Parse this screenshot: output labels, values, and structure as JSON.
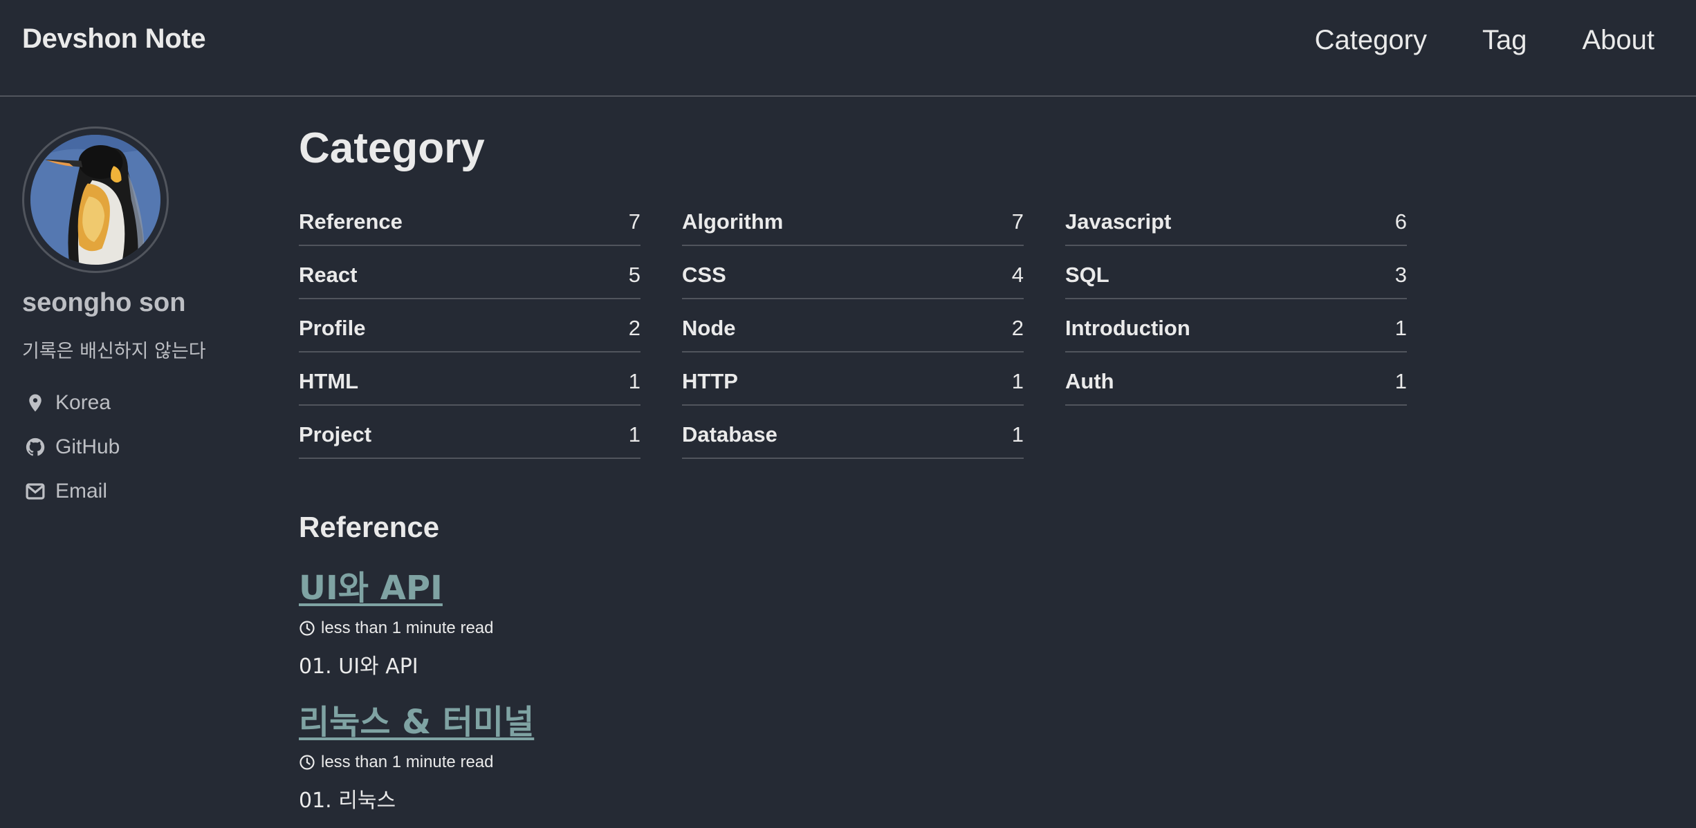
{
  "site": {
    "title": "Devshon Note"
  },
  "nav": {
    "items": [
      {
        "label": "Category"
      },
      {
        "label": "Tag"
      },
      {
        "label": "About"
      }
    ]
  },
  "author": {
    "name": "seongho son",
    "bio": "기록은 배신하지 않는다",
    "links": [
      {
        "label": "Korea",
        "icon": "location-pin-icon"
      },
      {
        "label": "GitHub",
        "icon": "github-icon"
      },
      {
        "label": "Email",
        "icon": "envelope-icon"
      }
    ]
  },
  "page": {
    "title": "Category"
  },
  "categories": {
    "columns": [
      [
        {
          "name": "Reference",
          "count": "7"
        },
        {
          "name": "React",
          "count": "5"
        },
        {
          "name": "Profile",
          "count": "2"
        },
        {
          "name": "HTML",
          "count": "1"
        },
        {
          "name": "Project",
          "count": "1"
        }
      ],
      [
        {
          "name": "Algorithm",
          "count": "7"
        },
        {
          "name": "CSS",
          "count": "4"
        },
        {
          "name": "Node",
          "count": "2"
        },
        {
          "name": "HTTP",
          "count": "1"
        },
        {
          "name": "Database",
          "count": "1"
        }
      ],
      [
        {
          "name": "Javascript",
          "count": "6"
        },
        {
          "name": "SQL",
          "count": "3"
        },
        {
          "name": "Introduction",
          "count": "1"
        },
        {
          "name": "Auth",
          "count": "1"
        }
      ]
    ]
  },
  "section": {
    "title": "Reference",
    "posts": [
      {
        "title": "UI와 API",
        "read_time": "less than 1 minute read",
        "excerpt": "01. UI와 API"
      },
      {
        "title": "리눅스 & 터미널",
        "read_time": "less than 1 minute read",
        "excerpt": "01. 리눅스"
      }
    ]
  },
  "colors": {
    "background": "#252a34",
    "text": "#eaeaea",
    "muted": "#bdbfc4",
    "link": "#7fa3a3",
    "divider": "#51555d"
  }
}
